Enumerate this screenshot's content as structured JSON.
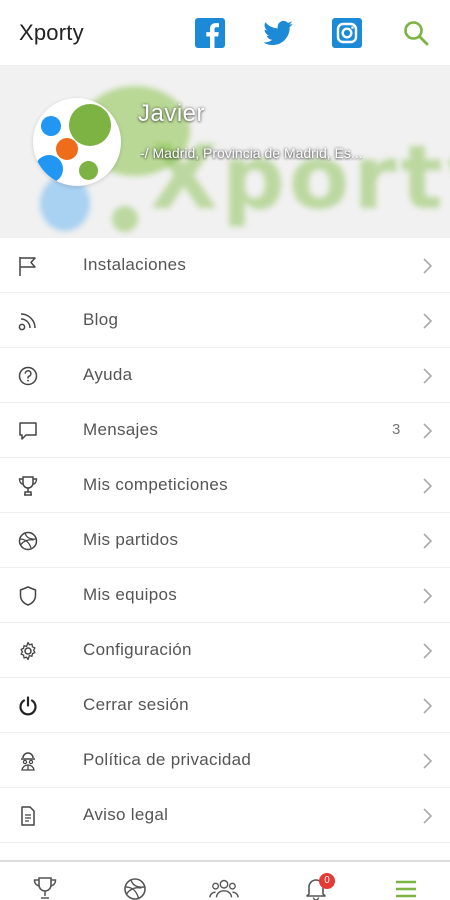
{
  "header": {
    "title": "Xporty",
    "icons": [
      "facebook-icon",
      "twitter-icon",
      "instagram-icon",
      "search-icon"
    ]
  },
  "profile": {
    "name": "Javier",
    "location": "-/ Madrid, Provincia de Madrid, Es...",
    "hero_watermark": "Xporty"
  },
  "menu": {
    "items": [
      {
        "label": "Instalaciones",
        "icon": "flag-icon"
      },
      {
        "label": "Blog",
        "icon": "rss-icon"
      },
      {
        "label": "Ayuda",
        "icon": "help-icon"
      },
      {
        "label": "Mensajes",
        "icon": "message-icon",
        "count": "3"
      },
      {
        "label": "Mis competiciones",
        "icon": "trophy-icon"
      },
      {
        "label": "Mis partidos",
        "icon": "ball-icon"
      },
      {
        "label": "Mis equipos",
        "icon": "shield-icon"
      },
      {
        "label": "Configuración",
        "icon": "gear-icon"
      },
      {
        "label": "Cerrar sesión",
        "icon": "power-icon"
      },
      {
        "label": "Política de privacidad",
        "icon": "privacy-icon"
      },
      {
        "label": "Aviso legal",
        "icon": "document-icon"
      }
    ]
  },
  "bottom_nav": {
    "items": [
      "trophy-icon",
      "ball-icon",
      "group-icon",
      "bell-icon",
      "menu-icon"
    ],
    "notification_badge": "0",
    "active": "menu-icon"
  },
  "colors": {
    "accent": "#7cb342",
    "facebook": "#1c8ad6",
    "twitter": "#1da1f2",
    "instagram": "#1c8ad6",
    "badge": "#e53935"
  }
}
